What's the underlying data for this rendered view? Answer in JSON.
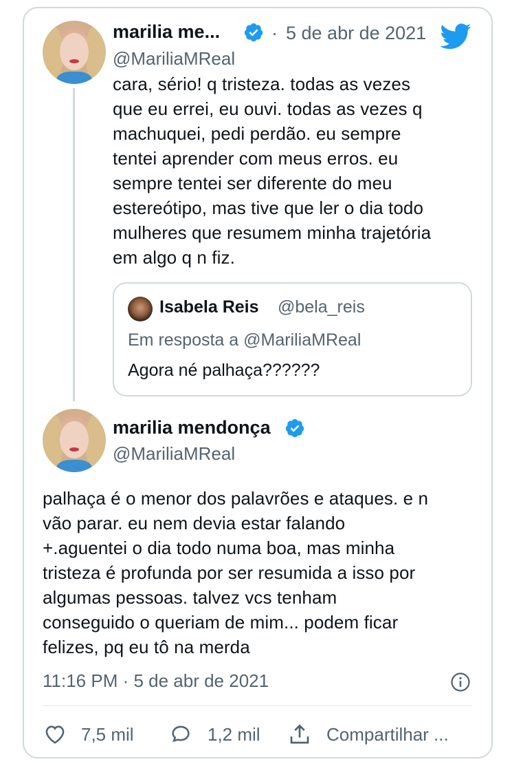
{
  "tweet1": {
    "name": "marilia me...",
    "handle": "@MariliaMReal",
    "separator": "·",
    "date": "5 de abr de 2021",
    "text_lines": [
      "cara, sério! q tristeza. todas as vezes",
      "que eu errei, eu ouvi. todas as vezes q",
      "machuquei, pedi perdão. eu sempre",
      "tentei aprender com meus erros. eu",
      "sempre tentei ser diferente do meu",
      "estereótipo, mas tive que ler o dia todo",
      "mulheres que resumem minha trajetória",
      "em algo q n fiz."
    ]
  },
  "quote": {
    "name": "Isabela Reis",
    "handle": "@bela_reis",
    "reply_to": "Em resposta a @MariliaMReal",
    "text": "Agora né palhaça??????"
  },
  "tweet2": {
    "name": "marilia mendonça",
    "handle": "@MariliaMReal",
    "text_lines": [
      "palhaça é o menor dos palavrões e ataques. e n",
      "vão parar. eu nem devia estar falando",
      "+.aguentei o dia todo numa boa, mas minha",
      "tristeza é profunda por ser resumida a isso por",
      "algumas pessoas. talvez vcs tenham",
      "conseguido o queriam de mim... podem ficar",
      "felizes, pq eu tô na merda"
    ],
    "timestamp": "11:16 PM · 5 de abr de 2021"
  },
  "actions": {
    "likes": "7,5 mil",
    "replies": "1,2 mil",
    "share": "Compartilhar ..."
  },
  "colors": {
    "twitter_blue": "#1d9bf0",
    "text_primary": "#0f1419",
    "text_secondary": "#536471",
    "border": "#cfd9de"
  },
  "icons": [
    "twitter-bird-icon",
    "verified-badge-icon",
    "info-icon",
    "heart-icon",
    "reply-icon",
    "share-icon"
  ]
}
